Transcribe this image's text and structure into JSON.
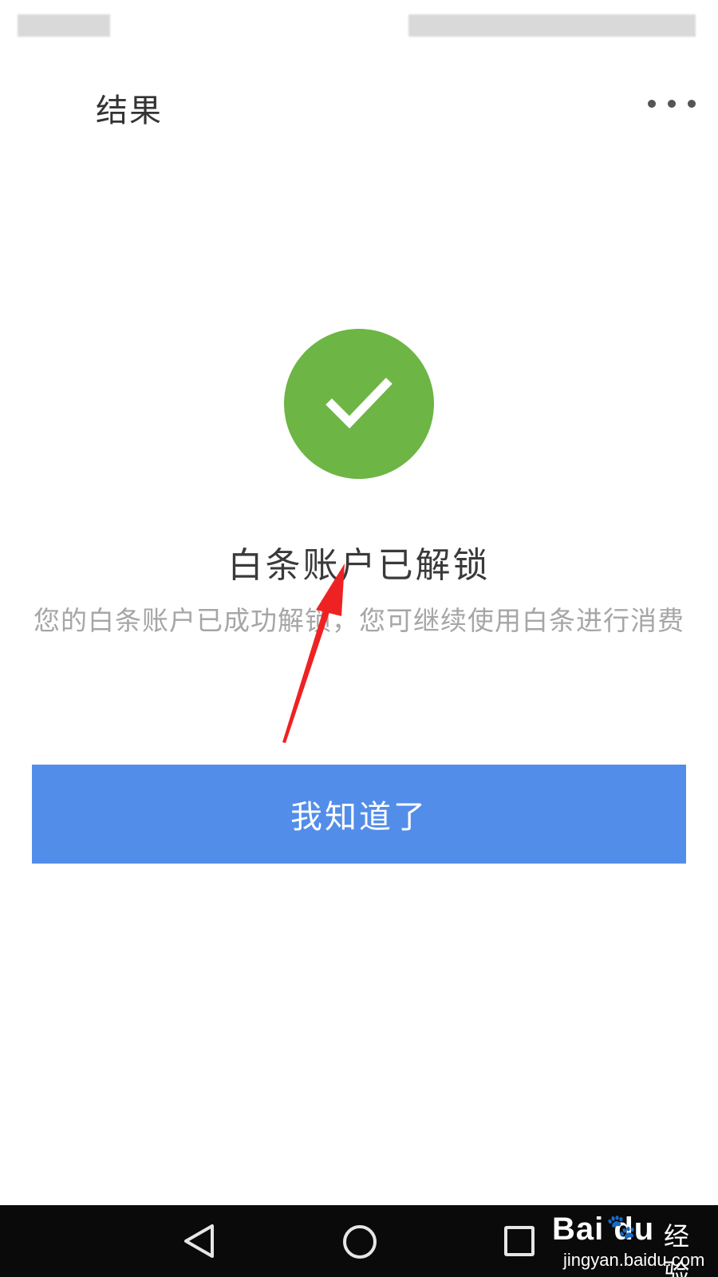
{
  "header": {
    "title": "结果",
    "more_icon": "more-horizontal-icon"
  },
  "result": {
    "icon": "check-icon",
    "icon_color": "#6db544",
    "title": "白条账户已解锁",
    "description": "您的白条账户已成功解锁，您可继续使用白条进行消费"
  },
  "action": {
    "confirm_label": "我知道了",
    "button_color": "#528dea"
  },
  "annotation": {
    "arrow_color": "#ee2222"
  },
  "nav_bar": {
    "back_icon": "nav-back-icon",
    "home_icon": "nav-home-icon",
    "recent_icon": "nav-recent-apps-icon"
  },
  "watermark": {
    "logo": "Bai  du",
    "brand": "经验",
    "url": "jingyan.baidu.com"
  }
}
